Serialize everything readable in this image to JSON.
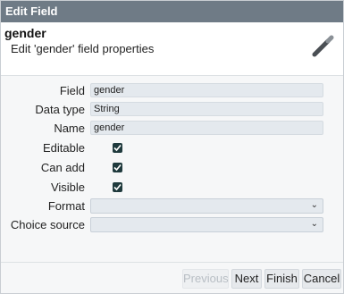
{
  "window": {
    "title": "Edit Field"
  },
  "header": {
    "title": "gender",
    "subtitle": "Edit 'gender' field properties",
    "icon": "wand-icon"
  },
  "form": {
    "field": {
      "label": "Field",
      "value": "gender"
    },
    "data_type": {
      "label": "Data type",
      "value": "String"
    },
    "name": {
      "label": "Name",
      "value": "gender"
    },
    "editable": {
      "label": "Editable",
      "checked": true
    },
    "can_add": {
      "label": "Can add",
      "checked": true
    },
    "visible": {
      "label": "Visible",
      "checked": true
    },
    "format": {
      "label": "Format",
      "value": ""
    },
    "choice_source": {
      "label": "Choice source",
      "value": ""
    }
  },
  "footer": {
    "previous_label": "Previous",
    "next_label": "Next",
    "finish_label": "Finish",
    "cancel_label": "Cancel"
  },
  "colors": {
    "titlebar": "#6f7b86",
    "checkbox": "#1f3a3d",
    "field_bg": "#e4e9ee"
  }
}
